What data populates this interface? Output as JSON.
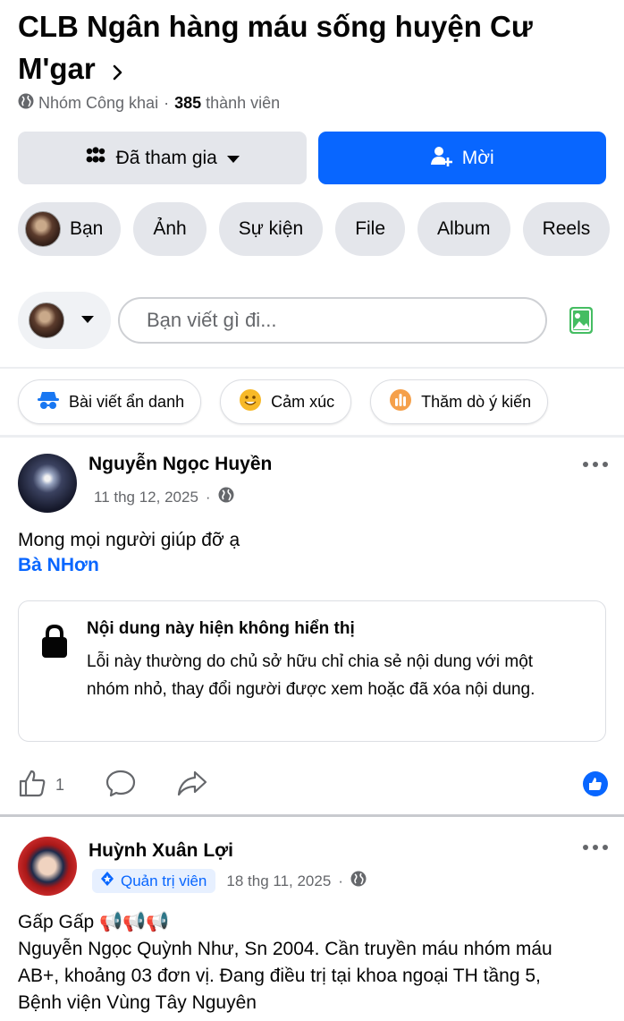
{
  "group": {
    "title": "CLB Ngân hàng máu sống huyện Cư M'gar",
    "privacy": "Nhóm Công khai",
    "member_count": "385",
    "member_label": "thành viên"
  },
  "buttons": {
    "joined_label": "Đã tham gia",
    "invite_label": "Mời"
  },
  "chips": [
    "Bạn",
    "Ảnh",
    "Sự kiện",
    "File",
    "Album",
    "Reels"
  ],
  "composer": {
    "placeholder": "Bạn viết gì đi..."
  },
  "quick_actions": {
    "anonymous": "Bài viết ẩn danh",
    "feeling": "Cảm xúc",
    "poll": "Thăm dò ý kiến"
  },
  "post1": {
    "author": "Nguyễn Ngọc Huyền",
    "date": "11 thg 12, 2025",
    "text": "Mong mọi người giúp đỡ ạ",
    "tag": "Bà NHơn",
    "unavailable_title": "Nội dung này hiện không hiển thị",
    "unavailable_body": "Lỗi này thường do chủ sở hữu chỉ chia sẻ nội dung với một nhóm nhỏ, thay đổi người được xem hoặc đã xóa nội dung.",
    "like_count": "1"
  },
  "post2": {
    "author": "Huỳnh Xuân Lợi",
    "role": "Quản trị viên",
    "date": "18 thg 11, 2025",
    "line1": "Gấp Gấp 📢📢📢",
    "line2": "Nguyễn Ngọc Quỳnh Như, Sn 2004. Cần truyền máu nhóm máu AB+,  khoảng 03 đơn vị. Đang điều trị tại khoa ngoại TH tầng 5,  Bệnh viện Vùng Tây Nguyên"
  },
  "colors": {
    "primary": "#0866ff",
    "secondary_bg": "#e4e6eb",
    "muted_text": "#65676b"
  }
}
